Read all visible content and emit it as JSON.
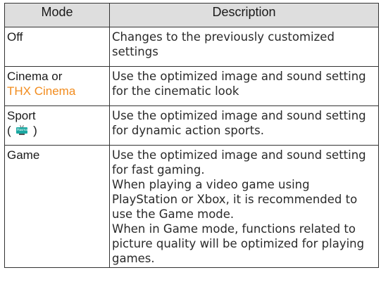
{
  "table": {
    "headers": {
      "mode": "Mode",
      "description": "Description"
    },
    "rows": [
      {
        "mode": "Off",
        "description": "Changes to the previously customized settings"
      },
      {
        "mode": "Cinema or",
        "mode_extra": "THX Cinema",
        "description": "Use the optimized image and sound setting for the cinematic look"
      },
      {
        "mode": "Sport",
        "mode_note_open": "(",
        "mode_note_icon": "Plasma",
        "mode_note_close": ")",
        "description": "Use the optimized image and sound setting for dynamic action sports."
      },
      {
        "mode": "Game",
        "description": [
          "Use the optimized image and sound setting for fast gaming.",
          "When playing a video game using PlayStation or Xbox, it is recommended to use the Game mode.",
          "When in Game mode, functions related to picture quality will be optimized for playing games."
        ]
      }
    ]
  },
  "colors": {
    "header_bg": "#dedede",
    "thx_accent": "#f28c1e",
    "plasma_icon": "#1aa7a1"
  },
  "icons": {
    "plasma": "plasma-tv-icon"
  }
}
